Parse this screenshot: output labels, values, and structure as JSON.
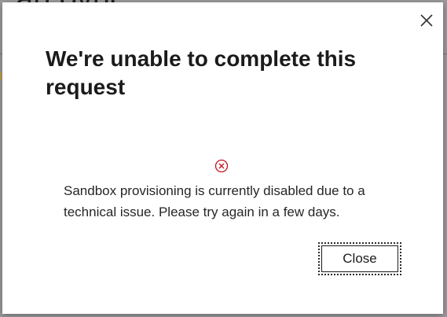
{
  "background": {
    "heading_fragment": "an ovuc"
  },
  "dialog": {
    "title": "We're unable to complete this request",
    "status_icon": "error-circle-x-icon",
    "message": "Sandbox provisioning is currently disabled due to a technical issue. Please try again in a few days.",
    "close_button_label": "Close",
    "close_icon": "close-icon",
    "colors": {
      "error": "#c50f1f",
      "title": "#1b1b1b",
      "background": "#ffffff"
    }
  }
}
